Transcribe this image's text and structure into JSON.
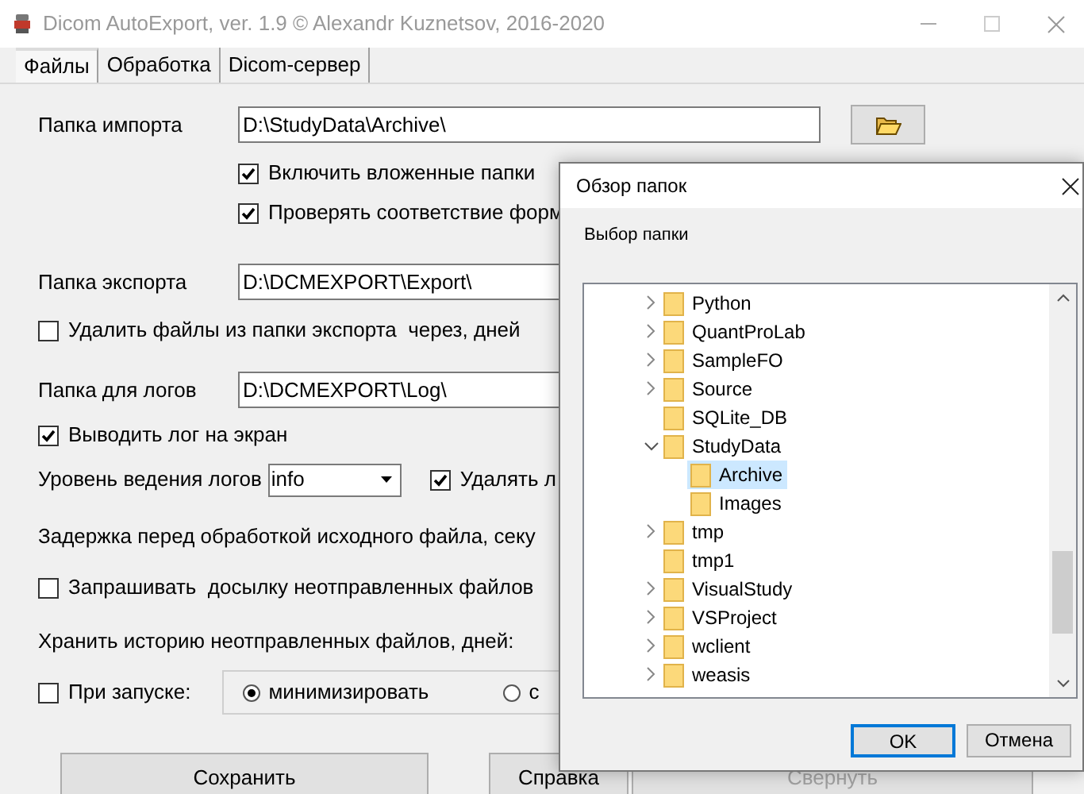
{
  "window": {
    "title": "Dicom AutoExport, ver. 1.9 © Alexandr Kuznetsov, 2016-2020"
  },
  "tabs": [
    {
      "label": "Файлы",
      "selected": true
    },
    {
      "label": "Обработка",
      "selected": false
    },
    {
      "label": "Dicom-сервер",
      "selected": false
    }
  ],
  "import_folder": {
    "label": "Папка импорта",
    "value": "D:\\StudyData\\Archive\\"
  },
  "include_subfolders": {
    "label": "Включить вложенные папки",
    "checked": true
  },
  "check_format": {
    "label": "Проверять соответствие форм",
    "checked": true
  },
  "export_folder": {
    "label": "Папка экспорта",
    "value": "D:\\DCMEXPORT\\Export\\"
  },
  "delete_export": {
    "label": "Удалить файлы из папки экспорта  через, дней",
    "checked": false
  },
  "log_folder": {
    "label": "Папка для логов",
    "value": "D:\\DCMEXPORT\\Log\\"
  },
  "show_log": {
    "label": "Выводить лог на экран",
    "checked": true
  },
  "log_level": {
    "label": "Уровень ведения логов",
    "value": "info"
  },
  "delete_logs": {
    "label": "Удалять л",
    "checked": true
  },
  "delay_label": "Задержка перед обработкой исходного файла, секу",
  "request_resend": {
    "label": "Запрашивать  досылку неотправленных файлов",
    "checked": false
  },
  "history_label": "Хранить историю неотправленных файлов, дней:",
  "on_startup": {
    "label": "При запуске:",
    "checked": false,
    "options": [
      {
        "label": "минимизировать",
        "selected": true
      },
      {
        "label": "с",
        "selected": false
      }
    ]
  },
  "buttons": [
    {
      "label": "Сохранить",
      "disabled": false
    },
    {
      "label": "Справка",
      "disabled": false
    },
    {
      "label": "Свернуть",
      "disabled": true
    }
  ],
  "dialog": {
    "title": "Обзор папок",
    "prompt": "Выбор папки",
    "tree": [
      {
        "label": "Python",
        "expandable": true,
        "expanded": false,
        "selected": false
      },
      {
        "label": "QuantProLab",
        "expandable": true,
        "expanded": false,
        "selected": false
      },
      {
        "label": "SampleFO",
        "expandable": true,
        "expanded": false,
        "selected": false
      },
      {
        "label": "Source",
        "expandable": true,
        "expanded": false,
        "selected": false
      },
      {
        "label": "SQLite_DB",
        "expandable": false,
        "selected": false
      },
      {
        "label": "StudyData",
        "expandable": true,
        "expanded": true,
        "selected": false,
        "children": [
          {
            "label": "Archive",
            "expandable": false,
            "selected": true
          },
          {
            "label": "Images",
            "expandable": false,
            "selected": false
          }
        ]
      },
      {
        "label": "tmp",
        "expandable": true,
        "expanded": false,
        "selected": false
      },
      {
        "label": "tmp1",
        "expandable": false,
        "selected": false
      },
      {
        "label": "VisualStudy",
        "expandable": true,
        "expanded": false,
        "selected": false
      },
      {
        "label": "VSProject",
        "expandable": true,
        "expanded": false,
        "selected": false
      },
      {
        "label": "wclient",
        "expandable": true,
        "expanded": false,
        "selected": false
      },
      {
        "label": "weasis",
        "expandable": true,
        "expanded": false,
        "selected": false
      }
    ],
    "buttons": [
      {
        "label": "OK",
        "default": true
      },
      {
        "label": "Отмена",
        "default": false
      }
    ]
  }
}
